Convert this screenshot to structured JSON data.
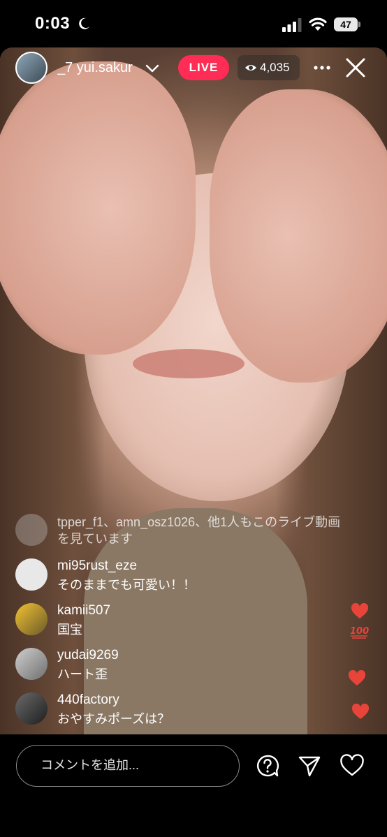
{
  "status_bar": {
    "time": "0:03",
    "battery": "47"
  },
  "header": {
    "host_name": "_7   yui.sakur",
    "live_label": "LIVE",
    "viewer_count": "4,035"
  },
  "system_message": "tpper_f1、amn_osz1026、他1人もこのライブ動画を見ています",
  "comments": [
    {
      "user": "mi95rust_eze",
      "text": "そのままでも可愛い！！"
    },
    {
      "user": "kamii507",
      "text": "国宝"
    },
    {
      "user": "yudai9269",
      "text": "ハート歪"
    },
    {
      "user": "440factory",
      "text": "おやすみポーズは？"
    }
  ],
  "reactions": [
    "heart",
    "100",
    "heart",
    "heart"
  ],
  "bottom_bar": {
    "comment_placeholder": "コメントを追加..."
  },
  "colors": {
    "live": "#ff2c55",
    "heart": "#e8443a"
  }
}
